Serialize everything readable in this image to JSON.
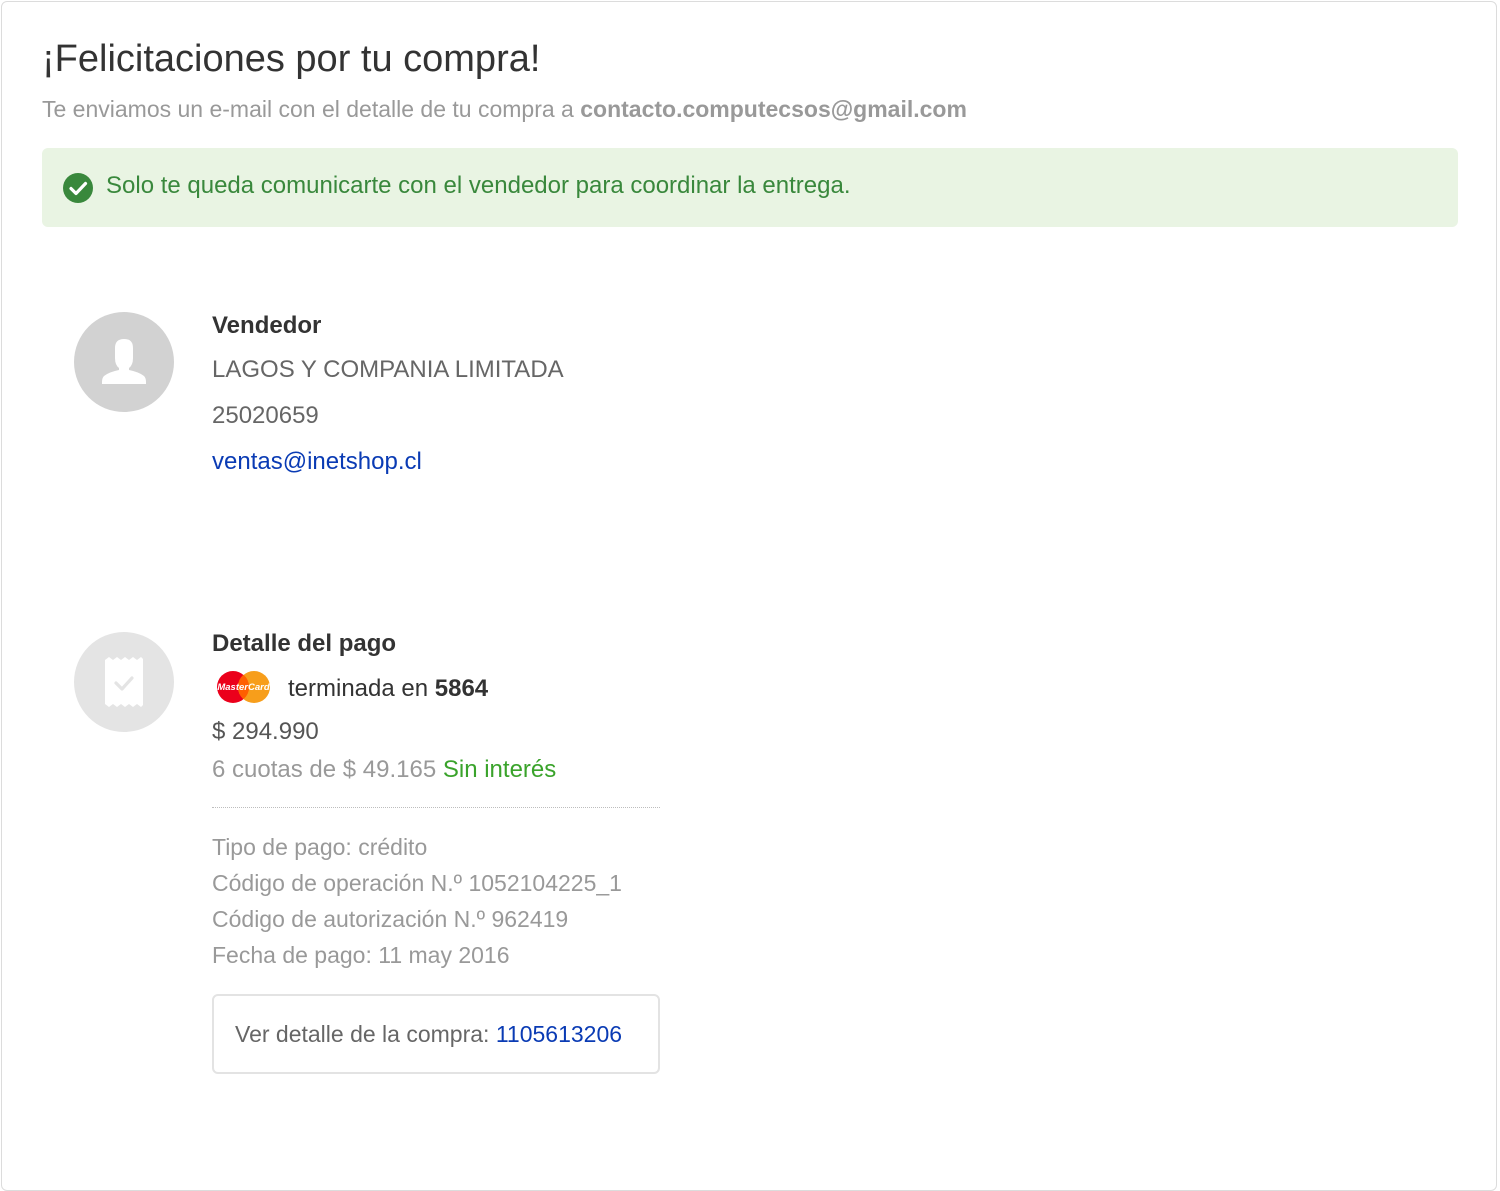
{
  "header": {
    "title": "¡Felicitaciones por tu compra!",
    "subtitle_prefix": "Te enviamos un e-mail con el detalle de tu compra a",
    "email": "contacto.computecsos@gmail.com"
  },
  "notice": {
    "icon": "check-circle-icon",
    "message": "Solo te queda comunicarte con el vendedor para coordinar la entrega.",
    "color": "#39883c",
    "background": "#e9f4e3"
  },
  "seller": {
    "icon": "user-avatar-icon",
    "heading": "Vendedor",
    "name": "LAGOS Y COMPANIA LIMITADA",
    "phone": "25020659",
    "email": "ventas@inetshop.cl"
  },
  "payment": {
    "icon": "receipt-icon",
    "heading": "Detalle del pago",
    "card_brand": "MasterCard",
    "card_prefix": "terminada en",
    "card_last_digits": "5864",
    "amount": "$ 294.990",
    "installments": "6 cuotas de $ 49.165",
    "interest": "Sin interés",
    "type": "Tipo de pago: crédito",
    "operation_code": "Código de operación N.º 1052104225_1",
    "authorization_code": "Código de autorización N.º 962419",
    "date": "Fecha de pago: 11 may 2016"
  },
  "order": {
    "label": "Ver detalle de la compra:",
    "number": "1105613206"
  },
  "colors": {
    "link": "#0a3bb4",
    "success_green": "#3aa32b",
    "mastercard_red": "#eb001b",
    "mastercard_yellow": "#f79e1b"
  }
}
